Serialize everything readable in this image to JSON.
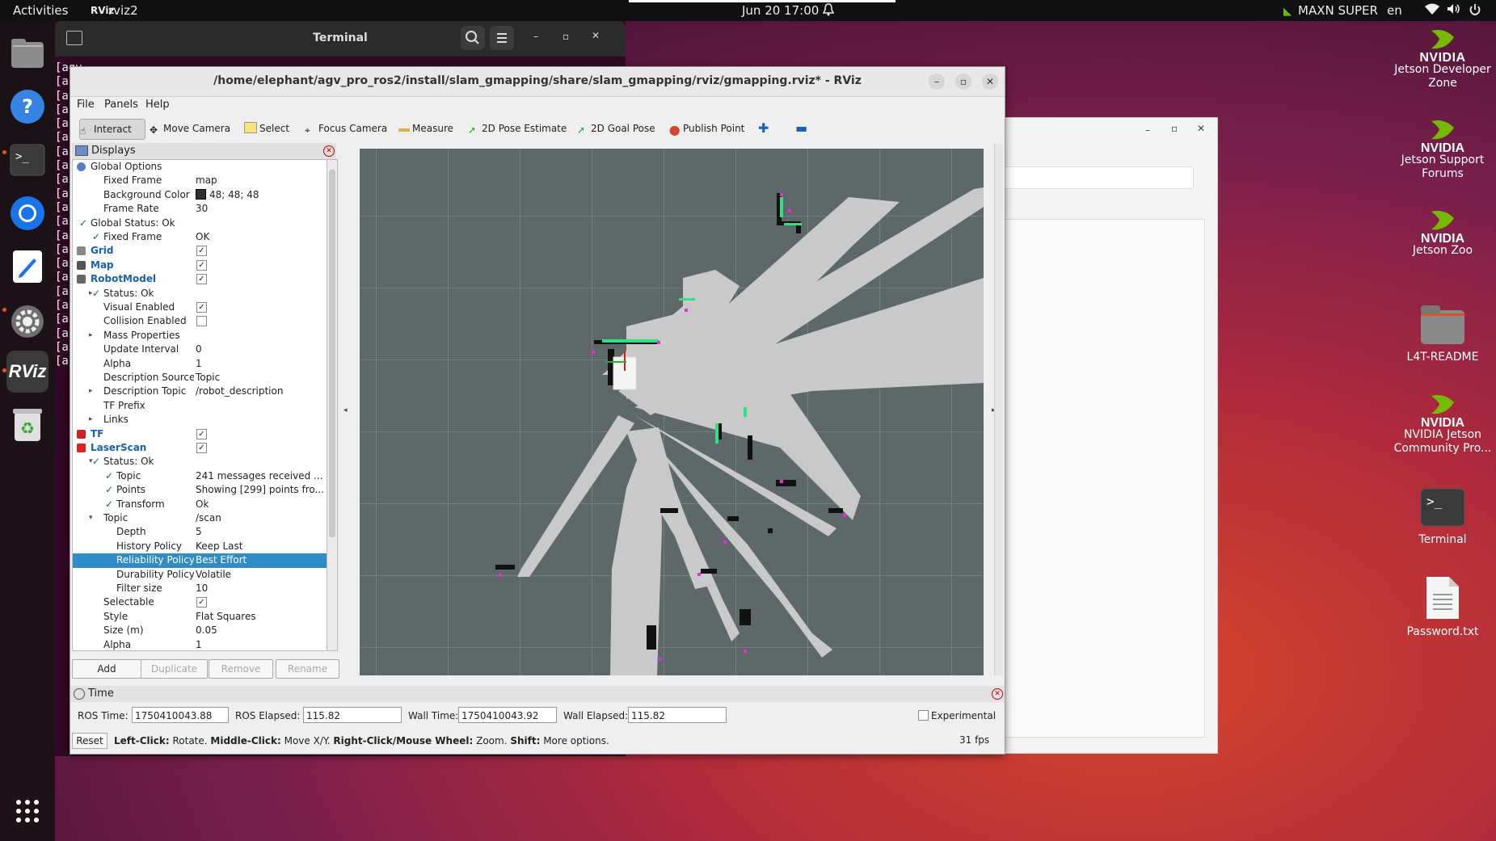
{
  "topbar": {
    "activities": "Activities",
    "app": "rviz2",
    "datetime": "Jun 20  17:00",
    "power_mode": "MAXN SUPER",
    "lang": "en"
  },
  "dock": {
    "items": [
      "files-icon",
      "help-icon",
      "terminal-icon",
      "chromium-icon",
      "text-editor-icon",
      "settings-icon",
      "rviz-icon",
      "trash-icon",
      "app-grid-icon"
    ]
  },
  "desktop": {
    "icons": [
      {
        "label": "Jetson Developer Zone",
        "brand": "NVIDIA"
      },
      {
        "label": "Jetson Support Forums",
        "brand": "NVIDIA"
      },
      {
        "label": "Jetson Zoo",
        "brand": "NVIDIA"
      },
      {
        "label": "L4T-README"
      },
      {
        "label": "NVIDIA Jetson Community Pro...",
        "brand": "NVIDIA"
      },
      {
        "label": "Terminal"
      },
      {
        "label": "Password.txt"
      }
    ]
  },
  "terminal": {
    "title": "Terminal",
    "lines": [
      "[agv_",
      "[a",
      "[a",
      "[a",
      "[a",
      "[a",
      "[a",
      "[a",
      "[a",
      "[a",
      "[a",
      "[a",
      "[a",
      "[a",
      "[a",
      "[a",
      "[a",
      "[a",
      "[a",
      "[a",
      "[a",
      "[a"
    ]
  },
  "rviz": {
    "title": "/home/elephant/agv_pro_ros2/install/slam_gmapping/share/slam_gmapping/rviz/gmapping.rviz* - RViz",
    "menu": [
      "File",
      "Panels",
      "Help"
    ],
    "tools": [
      "Interact",
      "Move Camera",
      "Select",
      "Focus Camera",
      "Measure",
      "2D Pose Estimate",
      "2D Goal Pose",
      "Publish Point"
    ],
    "displays_title": "Displays",
    "tree": [
      {
        "k": "Global Options",
        "v": "",
        "ind": 0,
        "icon": "gear-icon",
        "arrow": ""
      },
      {
        "k": "Fixed Frame",
        "v": "map",
        "ind": 1
      },
      {
        "k": "Background Color",
        "v": "48; 48; 48",
        "ind": 1,
        "swatch": true
      },
      {
        "k": "Frame Rate",
        "v": "30",
        "ind": 1
      },
      {
        "k": "Global Status: Ok",
        "v": "",
        "ind": 0,
        "check": true
      },
      {
        "k": "Fixed Frame",
        "v": "OK",
        "ind": 1,
        "check": true
      },
      {
        "k": "Grid",
        "v": "",
        "ind": 0,
        "blue": true,
        "box": "✓",
        "icon": "grid-icon"
      },
      {
        "k": "Map",
        "v": "",
        "ind": 0,
        "blue": true,
        "box": "✓",
        "icon": "map-icon"
      },
      {
        "k": "RobotModel",
        "v": "",
        "ind": 0,
        "blue": true,
        "box": "✓",
        "icon": "robot-icon"
      },
      {
        "k": "Status: Ok",
        "v": "",
        "ind": 1,
        "check": true,
        "arrow": "▸"
      },
      {
        "k": "Visual Enabled",
        "v": "",
        "ind": 1,
        "box": "✓"
      },
      {
        "k": "Collision Enabled",
        "v": "",
        "ind": 1,
        "box": " "
      },
      {
        "k": "Mass Properties",
        "v": "",
        "ind": 1,
        "arrow": "▸"
      },
      {
        "k": "Update Interval",
        "v": "0",
        "ind": 1
      },
      {
        "k": "Alpha",
        "v": "1",
        "ind": 1
      },
      {
        "k": "Description Source",
        "v": "Topic",
        "ind": 1
      },
      {
        "k": "Description Topic",
        "v": "/robot_description",
        "ind": 1,
        "arrow": "▸"
      },
      {
        "k": "TF Prefix",
        "v": "",
        "ind": 1
      },
      {
        "k": "Links",
        "v": "",
        "ind": 1,
        "arrow": "▸"
      },
      {
        "k": "TF",
        "v": "",
        "ind": 0,
        "blue": true,
        "box": "✓",
        "icon": "tf-icon"
      },
      {
        "k": "LaserScan",
        "v": "",
        "ind": 0,
        "blue": true,
        "box": "✓",
        "icon": "laser-icon"
      },
      {
        "k": "Status: Ok",
        "v": "",
        "ind": 1,
        "check": true,
        "arrow": "▾"
      },
      {
        "k": "Topic",
        "v": "241 messages received ...",
        "ind": 2,
        "check": true
      },
      {
        "k": "Points",
        "v": "Showing [299] points fro...",
        "ind": 2,
        "check": true
      },
      {
        "k": "Transform",
        "v": "Ok",
        "ind": 2,
        "check": true
      },
      {
        "k": "Topic",
        "v": "/scan",
        "ind": 1,
        "arrow": "▾"
      },
      {
        "k": "Depth",
        "v": "5",
        "ind": 2
      },
      {
        "k": "History Policy",
        "v": "Keep Last",
        "ind": 2
      },
      {
        "k": "Reliability Policy",
        "v": "Best Effort",
        "ind": 2,
        "sel": true
      },
      {
        "k": "Durability Policy",
        "v": "Volatile",
        "ind": 2
      },
      {
        "k": "Filter size",
        "v": "10",
        "ind": 2
      },
      {
        "k": "Selectable",
        "v": "",
        "ind": 1,
        "box": "✓"
      },
      {
        "k": "Style",
        "v": "Flat Squares",
        "ind": 1
      },
      {
        "k": "Size (m)",
        "v": "0.05",
        "ind": 1
      },
      {
        "k": "Alpha",
        "v": "1",
        "ind": 1
      }
    ],
    "panel_buttons": {
      "add": "Add",
      "duplicate": "Duplicate",
      "remove": "Remove",
      "rename": "Rename"
    },
    "time": {
      "title": "Time",
      "ros_time_label": "ROS Time:",
      "ros_time": "1750410043.88",
      "ros_elapsed_label": "ROS Elapsed:",
      "ros_elapsed": "115.82",
      "wall_time_label": "Wall Time:",
      "wall_time": "1750410043.92",
      "wall_elapsed_label": "Wall Elapsed:",
      "wall_elapsed": "115.82",
      "experimental": "Experimental"
    },
    "status": {
      "reset": "Reset",
      "b1": "Left-Click:",
      "t1": " Rotate. ",
      "b2": "Middle-Click:",
      "t2": " Move X/Y. ",
      "b3": "Right-Click/Mouse Wheel:",
      "t3": " Zoom. ",
      "b4": "Shift:",
      "t4": " More options.",
      "fps": "31 fps"
    }
  }
}
